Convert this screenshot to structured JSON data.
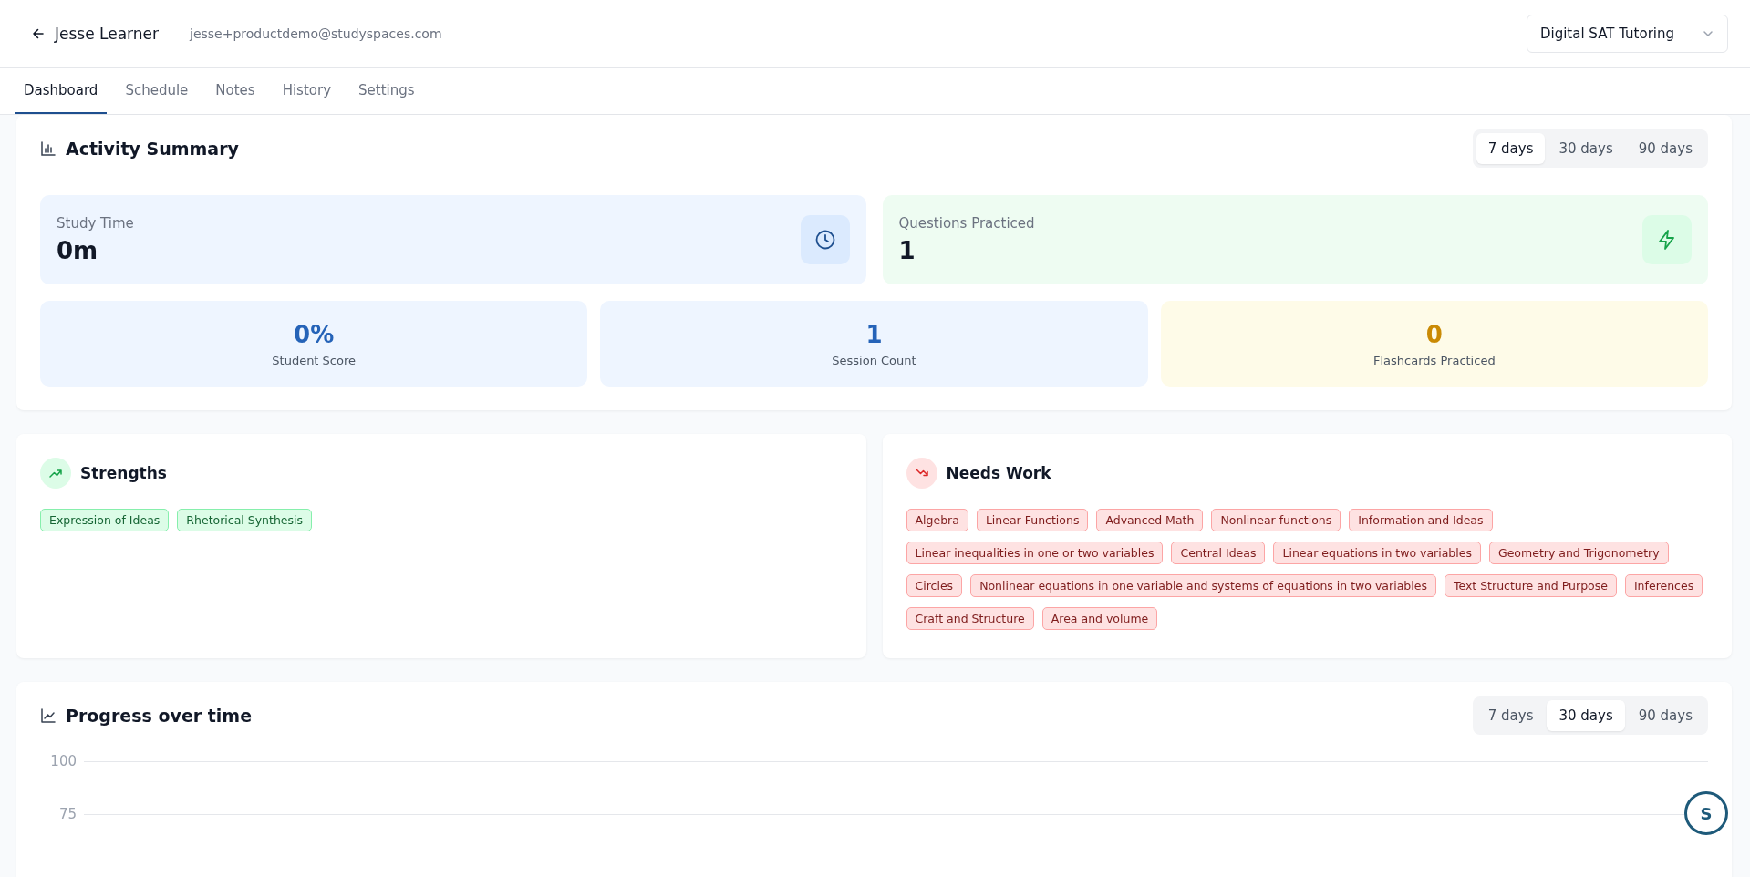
{
  "header": {
    "name": "Jesse Learner",
    "email": "jesse+productdemo@studyspaces.com",
    "course_select": {
      "value": "Digital SAT Tutoring"
    }
  },
  "tabs": [
    {
      "label": "Dashboard",
      "selected": true
    },
    {
      "label": "Schedule",
      "selected": false
    },
    {
      "label": "Notes",
      "selected": false
    },
    {
      "label": "History",
      "selected": false
    },
    {
      "label": "Settings",
      "selected": false
    }
  ],
  "activity_summary": {
    "title": "Activity Summary",
    "ranges": [
      {
        "label": "7 days",
        "selected": true
      },
      {
        "label": "30 days",
        "selected": false
      },
      {
        "label": "90 days",
        "selected": false
      }
    ],
    "highlights": [
      {
        "kind": "time",
        "label": "Study Time",
        "value": "0m"
      },
      {
        "kind": "questions",
        "label": "Questions Practiced",
        "value": "1"
      }
    ],
    "stats": [
      {
        "kind": "score",
        "value": "0%",
        "label": "Student Score"
      },
      {
        "kind": "sessions",
        "value": "1",
        "label": "Session Count"
      },
      {
        "kind": "flashcards",
        "value": "0",
        "label": "Flashcards Practiced"
      }
    ]
  },
  "strengths": {
    "title": "Strengths",
    "tags": [
      "Expression of Ideas",
      "Rhetorical Synthesis"
    ]
  },
  "needs_work": {
    "title": "Needs Work",
    "tags": [
      "Algebra",
      "Linear Functions",
      "Advanced Math",
      "Nonlinear functions",
      "Information and Ideas",
      "Linear inequalities in one or two variables",
      "Central Ideas",
      "Linear equations in two variables",
      "Geometry and Trigonometry",
      "Circles",
      "Nonlinear equations in one variable and systems of equations in two variables",
      "Text Structure and Purpose",
      "Inferences",
      "Craft and Structure",
      "Area and volume"
    ]
  },
  "progress": {
    "title": "Progress over time",
    "ranges": [
      {
        "label": "7 days",
        "selected": false
      },
      {
        "label": "30 days",
        "selected": true
      },
      {
        "label": "90 days",
        "selected": false
      }
    ],
    "y_labels": [
      "100",
      "75"
    ]
  },
  "help_button": {
    "label": "S"
  }
}
